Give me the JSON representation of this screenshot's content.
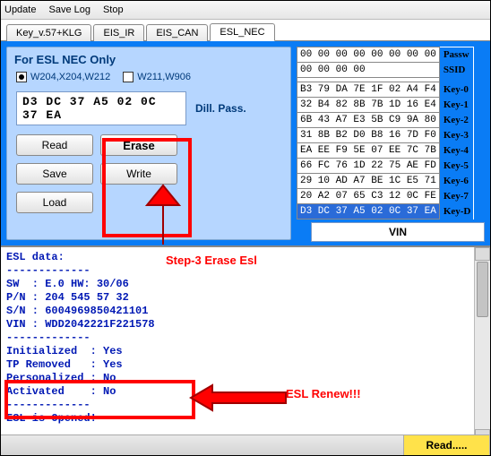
{
  "menu": {
    "update": "Update",
    "save_log": "Save Log",
    "stop": "Stop"
  },
  "tabs": {
    "t0": "Key_v.57+KLG",
    "t1": "EIS_IR",
    "t2": "EIS_CAN",
    "t3": "ESL_NEC"
  },
  "panel": {
    "title": "For ESL NEC Only",
    "r1": "W204,X204,W212",
    "r2": "W211,W906",
    "hex": "D3 DC 37 A5 02 0C 37 EA",
    "dill": "Dill. Pass.",
    "btn_read": "Read",
    "btn_erase": "Erase",
    "btn_save": "Save",
    "btn_write": "Write",
    "btn_load": "Load"
  },
  "keys": {
    "row0": "00 00 00 00 00 00 00 00",
    "row0b": "00 00 00 00",
    "row1": "B3 79 DA 7E 1F 02 A4 F4",
    "row2": "32 B4 82 8B 7B 1D 16 E4",
    "row3": "6B 43 A7 E3 5B C9 9A 80",
    "row4": "31 8B B2 D0 B8 16 7D F0",
    "row5": "EA EE F9 5E 07 EE 7C 7B",
    "row6": "66 FC 76 1D 22 75 AE FD",
    "row7": "29 10 AD A7 BE 1C E5 71",
    "row8": "20 A2 07 65 C3 12 0C FE",
    "row9": "D3 DC 37 A5 02 0C 37 EA",
    "lbl_p": "Passw",
    "lbl_s": "SSID",
    "lbl_k0": "Key-0",
    "lbl_k1": "Key-1",
    "lbl_k2": "Key-2",
    "lbl_k3": "Key-3",
    "lbl_k4": "Key-4",
    "lbl_k5": "Key-5",
    "lbl_k6": "Key-6",
    "lbl_k7": "Key-7",
    "lbl_kd": "Key-D"
  },
  "vin_label": "VIN",
  "log_text": "ESL data:\n-------------\nSW  : E.0 HW: 30/06\nP/N : 204 545 57 32\nS/N : 6004969850421101\nVIN : WDD2042221F221578\n-------------\nInitialized  : Yes\nTP Removed   : Yes\nPersonalized : No\nActivated    : No\n-------------\nESL is Opened!\n",
  "status": {
    "read": "Read....."
  },
  "annotations": {
    "step3": "Step-3 Erase Esl",
    "renew": "ESL Renew!!!"
  }
}
